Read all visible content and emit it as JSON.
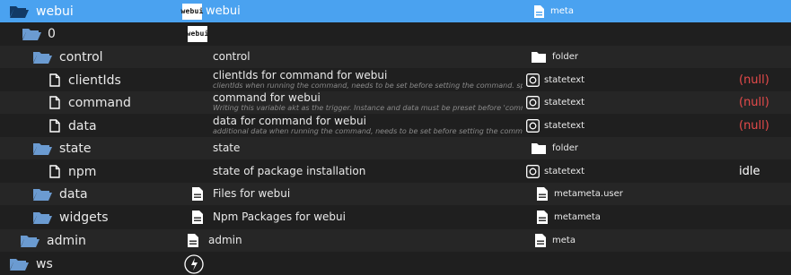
{
  "rows": [
    {
      "name": "webui",
      "title": "webui",
      "subtitle": "",
      "type": "meta",
      "value": ""
    },
    {
      "name": "0",
      "title": "",
      "subtitle": "",
      "type": "",
      "value": ""
    },
    {
      "name": "control",
      "title": "control",
      "subtitle": "",
      "type": "folder",
      "value": ""
    },
    {
      "name": "clientIds",
      "title": "clientIds for command for webui",
      "subtitle": "clientIds when running the command, needs to be set before setting the command. splitted by ;",
      "type": "statetext",
      "value": "(null)"
    },
    {
      "name": "command",
      "title": "command for webui",
      "subtitle": "Writing this variable akt as the trigger. Instance and data must be preset before 'command' will be w",
      "type": "statetext",
      "value": "(null)"
    },
    {
      "name": "data",
      "title": "data for command for webui",
      "subtitle": "additional data when running the command, needs to be set before setting the command.",
      "type": "statetext",
      "value": "(null)"
    },
    {
      "name": "state",
      "title": "state",
      "subtitle": "",
      "type": "folder",
      "value": ""
    },
    {
      "name": "npm",
      "title": "state of package installation",
      "subtitle": "",
      "type": "statetext",
      "value": "idle"
    },
    {
      "name": "data",
      "title": "Files for webui",
      "subtitle": "",
      "type": "metameta.user",
      "value": ""
    },
    {
      "name": "widgets",
      "title": "Npm Packages for webui",
      "subtitle": "",
      "type": "metameta",
      "value": ""
    },
    {
      "name": "admin",
      "title": "admin",
      "subtitle": "",
      "type": "meta",
      "value": ""
    },
    {
      "name": "ws",
      "title": "",
      "subtitle": "",
      "type": "",
      "value": ""
    }
  ],
  "badge_text": "webui",
  "colors": {
    "selected_row": "#4aa2f0",
    "null_value": "#e84b4b",
    "background": "#1f1f1f"
  },
  "icons": {
    "folder": "folder-icon",
    "folder_open": "folder-open-icon",
    "file": "file-icon",
    "document": "document-icon",
    "state": "state-icon",
    "adapter_logo": "webui-logo-icon",
    "ws_logo": "ws-logo-icon"
  }
}
